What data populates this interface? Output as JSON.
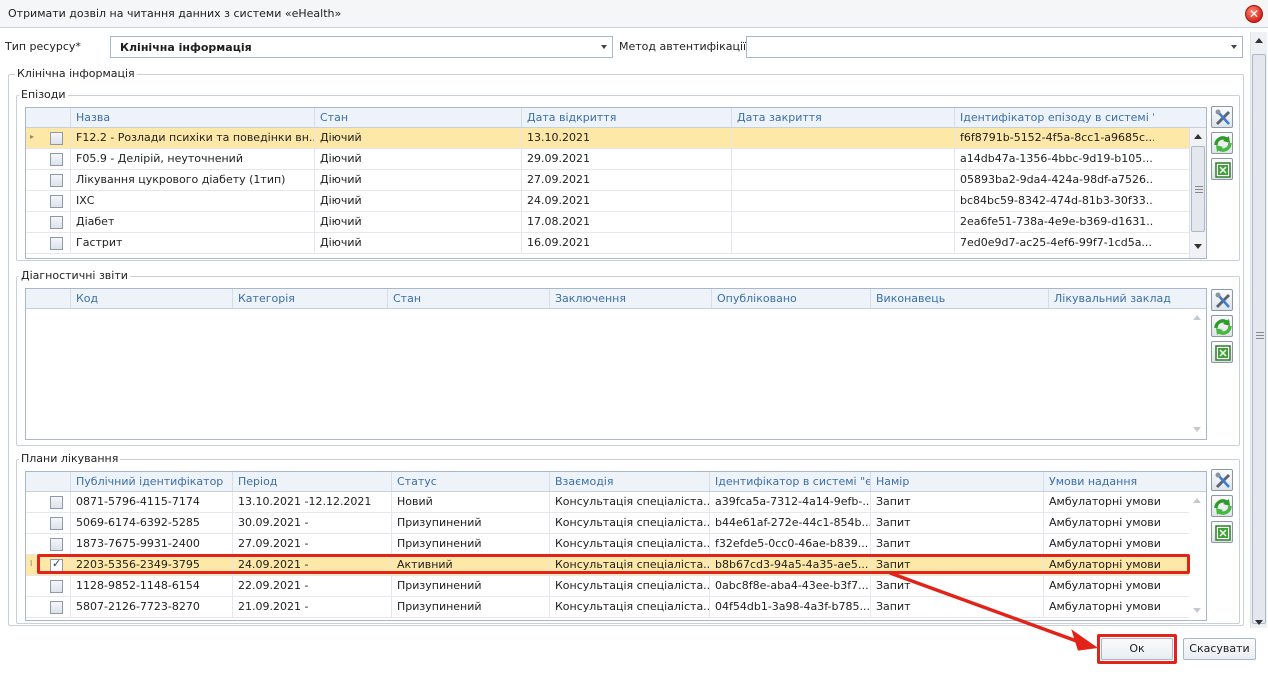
{
  "window": {
    "title": "Отримати дозвіл на читання данних з системи «eHealth»",
    "close_icon": "close-icon"
  },
  "form": {
    "resource_type_label": "Тип ресурсу*",
    "resource_type_value": "Клінічна інформація",
    "auth_method_label": "Метод автентифікації",
    "auth_method_value": ""
  },
  "clinical_group": {
    "label": "Клінічна інформація"
  },
  "episodes": {
    "label": "Епізоди",
    "columns": [
      "Назва",
      "Стан",
      "Дата відкриття",
      "Дата закриття",
      "Ідентифікатор епізоду в системі \"є"
    ],
    "rows": [
      {
        "name": "F12.2 - Розлади психіки та поведінки вн...",
        "state": "Діючий",
        "opened": "13.10.2021",
        "closed": "",
        "id": "f6f8791b-5152-4f5a-8cc1-a9685c...",
        "checked": false,
        "selected": true
      },
      {
        "name": "F05.9 - Делірій, неуточнений",
        "state": "Діючий",
        "opened": "29.09.2021",
        "closed": "",
        "id": "a14db47a-1356-4bbc-9d19-b105...",
        "checked": false,
        "selected": false
      },
      {
        "name": "Лікування цукрового діабету (1тип)",
        "state": "Діючий",
        "opened": "27.09.2021",
        "closed": "",
        "id": "05893ba2-9da4-424a-98df-a7526...",
        "checked": false,
        "selected": false
      },
      {
        "name": "ІХС",
        "state": "Діючий",
        "opened": "24.09.2021",
        "closed": "",
        "id": "bc84bc59-8342-474d-81b3-30f33...",
        "checked": false,
        "selected": false
      },
      {
        "name": "Діабет",
        "state": "Діючий",
        "opened": "17.08.2021",
        "closed": "",
        "id": "2ea6fe51-738a-4e9e-b369-d1631...",
        "checked": false,
        "selected": false
      },
      {
        "name": "Гастрит",
        "state": "Діючий",
        "opened": "16.09.2021",
        "closed": "",
        "id": "7ed0e9d7-ac25-4ef6-99f7-1cd5a...",
        "checked": false,
        "selected": false
      }
    ]
  },
  "diagnostic_reports": {
    "label": "Діагностичні звіти",
    "columns": [
      "Код",
      "Категорія",
      "Стан",
      "Заключення",
      "Опубліковано",
      "Виконавець",
      "Лікувальний заклад"
    ],
    "rows": []
  },
  "treatment_plans": {
    "label": "Плани лікування",
    "columns": [
      "Публічний ідентифікатор",
      "Період",
      "Статус",
      "Взаємодія",
      "Ідентифікатор в системі \"eH",
      "Намір",
      "Умови надання"
    ],
    "rows": [
      {
        "public_id": "0871-5796-4115-7174",
        "period": "13.10.2021 -12.12.2021",
        "status": "Новий",
        "interaction": "Консультація спеціаліста...",
        "system_id": "a39fca5a-7312-4a14-9efb-...",
        "intent": "Запит",
        "conditions": "Амбулаторні умови",
        "checked": false,
        "selected": false
      },
      {
        "public_id": "5069-6174-6392-5285",
        "period": "30.09.2021 -",
        "status": "Призупинений",
        "interaction": "Консультація спеціаліста...",
        "system_id": "b44e61af-272e-44c1-854b...",
        "intent": "Запит",
        "conditions": "Амбулаторні умови",
        "checked": false,
        "selected": false
      },
      {
        "public_id": "1873-7675-9931-2400",
        "period": "27.09.2021 -",
        "status": "Призупинений",
        "interaction": "Консультація спеціаліста...",
        "system_id": "f32efde5-0cc0-46ae-b839...",
        "intent": "Запит",
        "conditions": "Амбулаторні умови",
        "checked": false,
        "selected": false
      },
      {
        "public_id": "2203-5356-2349-3795",
        "period": "24.09.2021 -",
        "status": "Активний",
        "interaction": "Консультація спеціаліста...",
        "system_id": "b8b67cd3-94a5-4a35-ae5...",
        "intent": "Запит",
        "conditions": "Амбулаторні умови",
        "checked": true,
        "selected": true
      },
      {
        "public_id": "1128-9852-1148-6154",
        "period": "22.09.2021 -",
        "status": "Призупинений",
        "interaction": "Консультація спеціаліста...",
        "system_id": "0abc8f8e-aba4-43ee-b3f7...",
        "intent": "Запит",
        "conditions": "Амбулаторні умови",
        "checked": false,
        "selected": false
      },
      {
        "public_id": "5807-2126-7723-8270",
        "period": "21.09.2021 -",
        "status": "Призупинений",
        "interaction": "Консультація спеціаліста...",
        "system_id": "04f54db1-3a98-4a3f-b785...",
        "intent": "Запит",
        "conditions": "Амбулаторні умови",
        "checked": false,
        "selected": false
      }
    ]
  },
  "buttons": {
    "ok": "Ок",
    "cancel": "Скасувати"
  },
  "colors": {
    "selected_row": "#fde8a8",
    "header_text": "#3a6fa8",
    "highlight": "#e2231a"
  },
  "toolbar_icons": [
    "settings-tools-icon",
    "refresh-icon",
    "export-icon"
  ]
}
